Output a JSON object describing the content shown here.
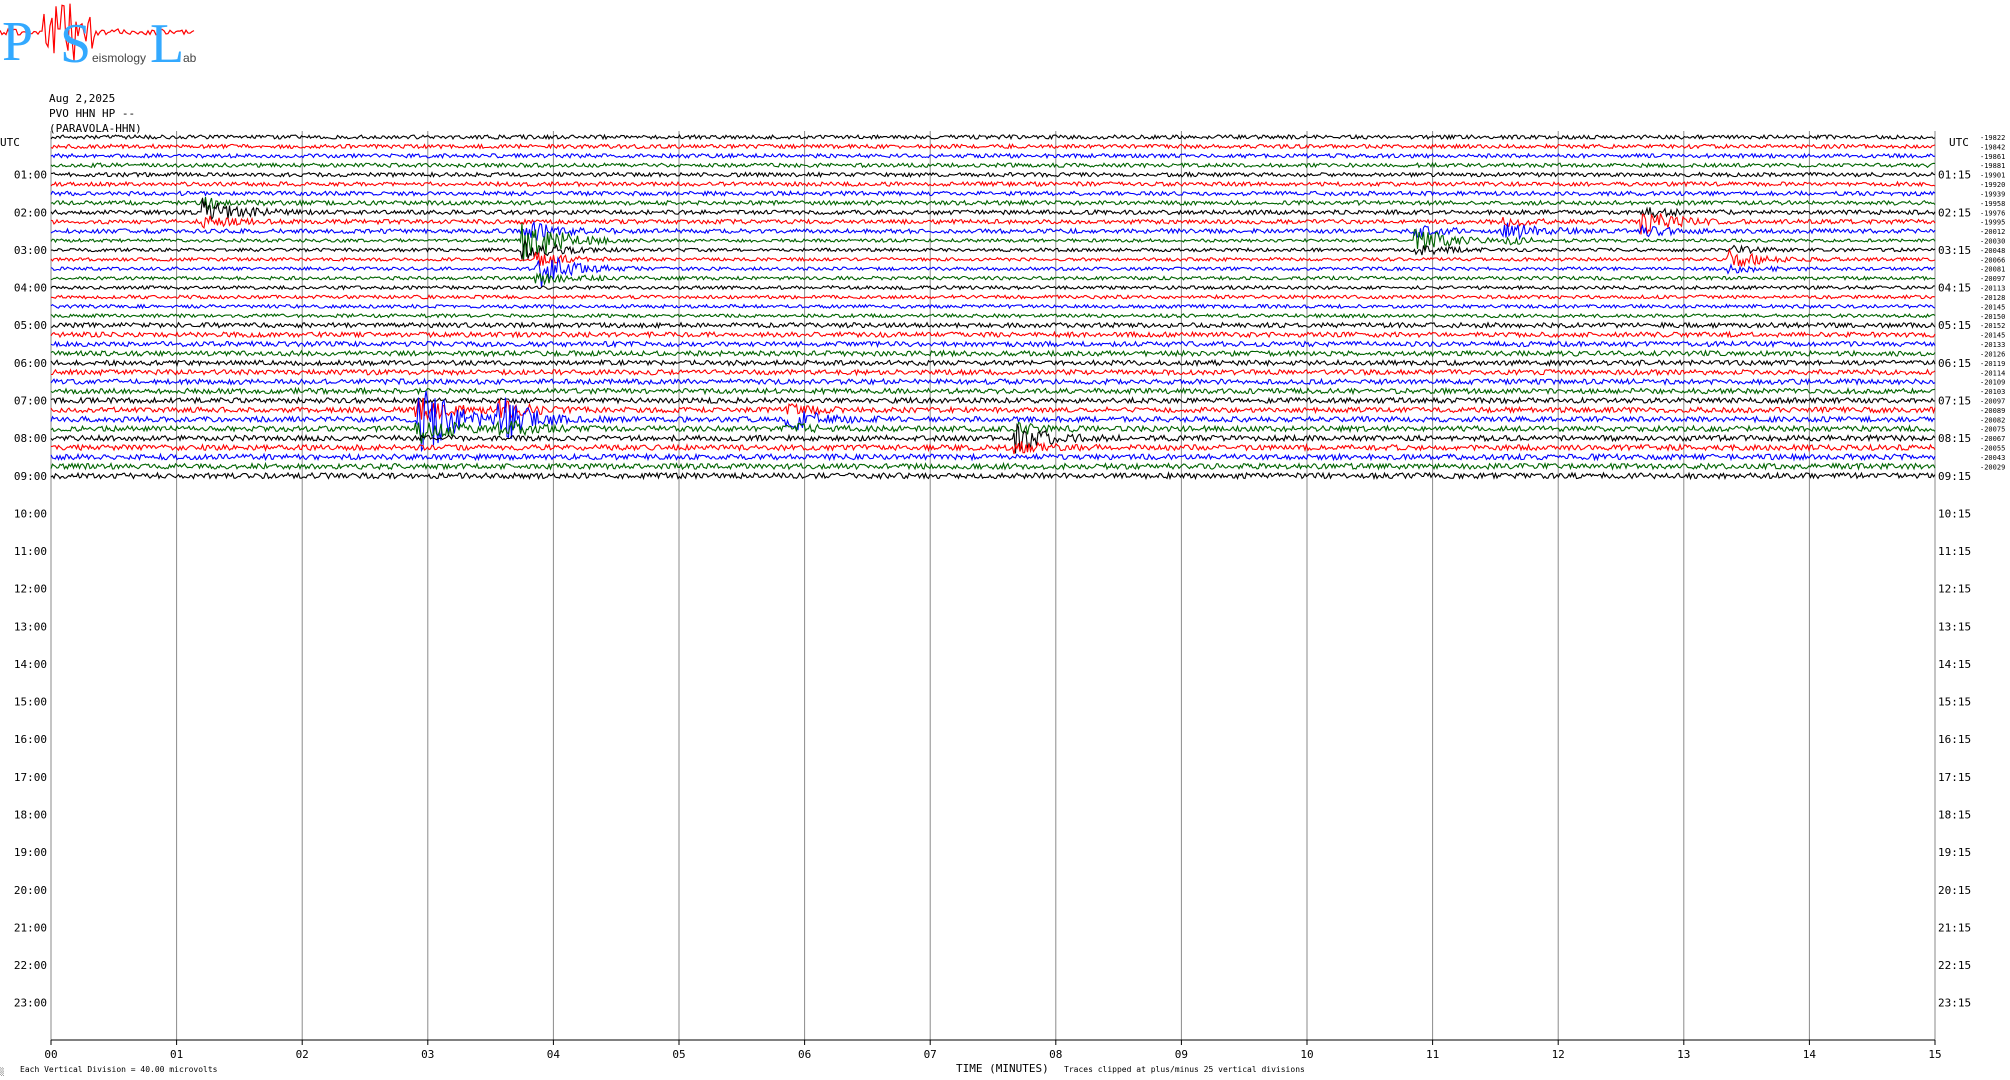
{
  "logo": {
    "letters": [
      "P",
      "S",
      "L"
    ],
    "small_words": [
      "",
      "eismology",
      "ab"
    ],
    "colors": {
      "letters": "#33a9ff",
      "trace": "#ff0000",
      "text": "#444444"
    }
  },
  "header": {
    "date": "Aug 2,2025",
    "station": "PVO HHN HP --",
    "site": "(PARAVOLA-HHN)"
  },
  "footer": {
    "scale_note": "Each Vertical Division =   40.00 microvolts",
    "clip_note": "Traces clipped at plus/minus 25 vertical divisions",
    "corner_mark": "░"
  },
  "chart_data": {
    "type": "line",
    "title": "",
    "xlabel": "TIME (MINUTES)",
    "ylabel": "UTC",
    "right_axis_label": "UTC",
    "x_ticks": [
      "00",
      "01",
      "02",
      "03",
      "04",
      "05",
      "06",
      "07",
      "08",
      "09",
      "10",
      "11",
      "12",
      "13",
      "14",
      "15"
    ],
    "xlim": [
      0,
      15
    ],
    "left_hour_labels": [
      "01:00",
      "02:00",
      "03:00",
      "04:00",
      "05:00",
      "06:00",
      "07:00",
      "08:00",
      "09:00",
      "10:00",
      "11:00",
      "12:00",
      "13:00",
      "14:00",
      "15:00",
      "16:00",
      "17:00",
      "18:00",
      "19:00",
      "20:00",
      "21:00",
      "22:00",
      "23:00"
    ],
    "right_hour_labels": [
      "01:15",
      "02:15",
      "03:15",
      "04:15",
      "05:15",
      "06:15",
      "07:15",
      "08:15",
      "09:15",
      "10:15",
      "11:15",
      "12:15",
      "13:15",
      "14:15",
      "15:15",
      "16:15",
      "17:15",
      "18:15",
      "19:15",
      "20:15",
      "21:15",
      "22:15",
      "23:15"
    ],
    "rows_per_hour": 4,
    "rows_recorded": 37,
    "color_cycle": [
      "#000000",
      "#ff0000",
      "#0000ff",
      "#006400"
    ],
    "trace_offsets": [
      "-19822",
      "-19842",
      "-19861",
      "-19881",
      "-19901",
      "-19920",
      "-19939",
      "-19958",
      "-19976",
      "-19995",
      "-20012",
      "-20030",
      "-20048",
      "-20066",
      "-20081",
      "-20097",
      "-20113",
      "-20128",
      "-20145",
      "-20150",
      "-20152",
      "-20145",
      "-20133",
      "-20126",
      "-20119",
      "-20114",
      "-20109",
      "-20103",
      "-20097",
      "-20089",
      "-20082",
      "-20075",
      "-20067",
      "-20055",
      "-20043",
      "-20029"
    ],
    "events": [
      {
        "row": 8,
        "minute": 1.25,
        "amplitude": 3
      },
      {
        "row": 11,
        "minute": 3.8,
        "amplitude": 6
      },
      {
        "row": 14,
        "minute": 3.9,
        "amplitude": 4
      },
      {
        "row": 11,
        "minute": 10.9,
        "amplitude": 3
      },
      {
        "row": 10,
        "minute": 11.6,
        "amplitude": 2
      },
      {
        "row": 30,
        "minute": 2.95,
        "amplitude": 9
      },
      {
        "row": 30,
        "minute": 3.6,
        "amplitude": 5
      },
      {
        "row": 30,
        "minute": 5.9,
        "amplitude": 2.5
      },
      {
        "row": 32,
        "minute": 7.7,
        "amplitude": 3
      },
      {
        "row": 9,
        "minute": 12.7,
        "amplitude": 2.5
      },
      {
        "row": 13,
        "minute": 13.4,
        "amplitude": 2
      }
    ]
  }
}
